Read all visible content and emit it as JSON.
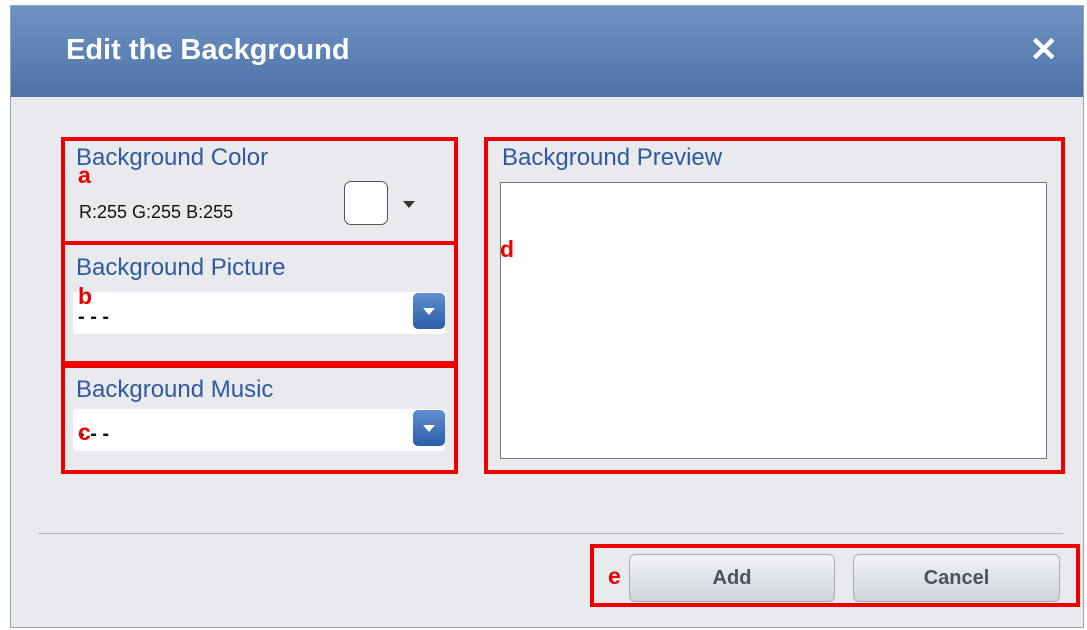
{
  "dialog": {
    "title": "Edit the Background",
    "close_icon": "close-icon",
    "close_glyph": "✕"
  },
  "background_color": {
    "label": "Background Color",
    "value_text": "R:255 G:255 B:255",
    "swatch_color": "#FFFFFF"
  },
  "background_picture": {
    "label": "Background Picture",
    "selected": "- - -"
  },
  "background_music": {
    "label": "Background Music",
    "selected": "- - -"
  },
  "background_preview": {
    "label": "Background Preview"
  },
  "buttons": {
    "add": "Add",
    "cancel": "Cancel"
  },
  "annotations": {
    "a": "a",
    "b": "b",
    "c": "c",
    "d": "d",
    "e": "e",
    "highlight_color": "#EE0000"
  },
  "colors": {
    "title_bar": "#5A7FB5",
    "section_label": "#31599D",
    "dialog_bg": "#E8EAEE"
  }
}
